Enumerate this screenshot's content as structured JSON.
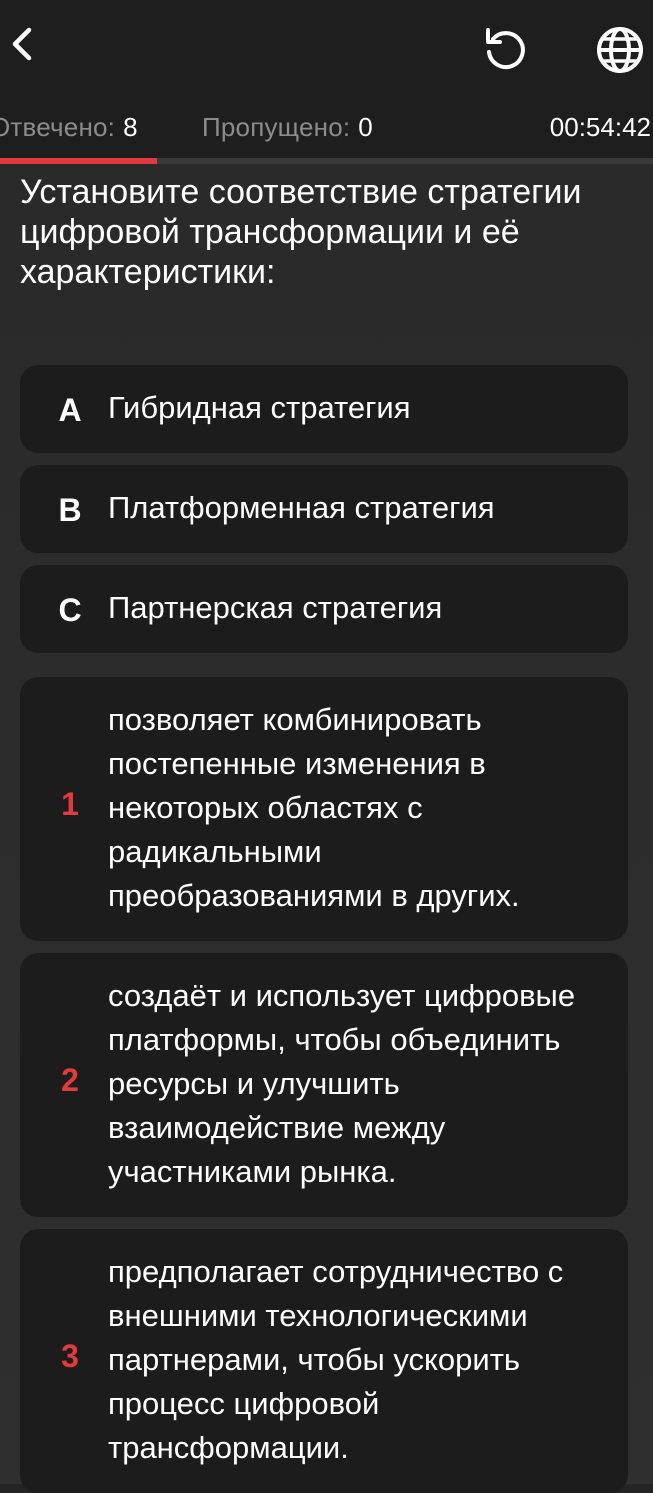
{
  "header": {
    "back_icon": "chevron-left-icon",
    "refresh_icon": "refresh-icon",
    "language_icon": "globe-icon"
  },
  "status": {
    "answered_label": "Отвечено:",
    "answered_count": "8",
    "skipped_label": "Пропущено:",
    "skipped_count": "0",
    "timer": "00:54:42",
    "progress_fraction": 0.24
  },
  "question": {
    "text": "Установите соответствие стратегии цифровой трансформации и её характеристики:"
  },
  "options": [
    {
      "key": "A",
      "label": "Гибридная стратегия"
    },
    {
      "key": "B",
      "label": "Платформенная стратегия"
    },
    {
      "key": "C",
      "label": "Партнерская стратегия"
    }
  ],
  "answers": [
    {
      "key": "1",
      "label": "позволяет комбинировать постепенные изменения в некоторых областях с радикальными преобразованиями в других."
    },
    {
      "key": "2",
      "label": "создаёт и использует цифровые платформы, чтобы объединить ресурсы и улучшить взаимодействие между участниками рынка."
    },
    {
      "key": "3",
      "label": "предполагает сотрудничество с внешними технологическими партнерами, чтобы ускорить процесс цифровой трансформации."
    }
  ],
  "colors": {
    "accent": "#e33a3e",
    "background": "#242424",
    "card": "#1c1c1c",
    "muted_text": "#8c8c8c"
  }
}
